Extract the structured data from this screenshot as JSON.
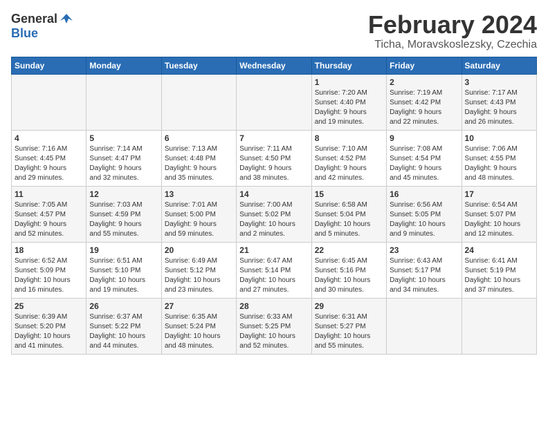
{
  "header": {
    "logo_general": "General",
    "logo_blue": "Blue",
    "month_title": "February 2024",
    "location": "Ticha, Moravskoslezsky, Czechia"
  },
  "days_of_week": [
    "Sunday",
    "Monday",
    "Tuesday",
    "Wednesday",
    "Thursday",
    "Friday",
    "Saturday"
  ],
  "weeks": [
    [
      {
        "day": "",
        "content": ""
      },
      {
        "day": "",
        "content": ""
      },
      {
        "day": "",
        "content": ""
      },
      {
        "day": "",
        "content": ""
      },
      {
        "day": "1",
        "content": "Sunrise: 7:20 AM\nSunset: 4:40 PM\nDaylight: 9 hours\nand 19 minutes."
      },
      {
        "day": "2",
        "content": "Sunrise: 7:19 AM\nSunset: 4:42 PM\nDaylight: 9 hours\nand 22 minutes."
      },
      {
        "day": "3",
        "content": "Sunrise: 7:17 AM\nSunset: 4:43 PM\nDaylight: 9 hours\nand 26 minutes."
      }
    ],
    [
      {
        "day": "4",
        "content": "Sunrise: 7:16 AM\nSunset: 4:45 PM\nDaylight: 9 hours\nand 29 minutes."
      },
      {
        "day": "5",
        "content": "Sunrise: 7:14 AM\nSunset: 4:47 PM\nDaylight: 9 hours\nand 32 minutes."
      },
      {
        "day": "6",
        "content": "Sunrise: 7:13 AM\nSunset: 4:48 PM\nDaylight: 9 hours\nand 35 minutes."
      },
      {
        "day": "7",
        "content": "Sunrise: 7:11 AM\nSunset: 4:50 PM\nDaylight: 9 hours\nand 38 minutes."
      },
      {
        "day": "8",
        "content": "Sunrise: 7:10 AM\nSunset: 4:52 PM\nDaylight: 9 hours\nand 42 minutes."
      },
      {
        "day": "9",
        "content": "Sunrise: 7:08 AM\nSunset: 4:54 PM\nDaylight: 9 hours\nand 45 minutes."
      },
      {
        "day": "10",
        "content": "Sunrise: 7:06 AM\nSunset: 4:55 PM\nDaylight: 9 hours\nand 48 minutes."
      }
    ],
    [
      {
        "day": "11",
        "content": "Sunrise: 7:05 AM\nSunset: 4:57 PM\nDaylight: 9 hours\nand 52 minutes."
      },
      {
        "day": "12",
        "content": "Sunrise: 7:03 AM\nSunset: 4:59 PM\nDaylight: 9 hours\nand 55 minutes."
      },
      {
        "day": "13",
        "content": "Sunrise: 7:01 AM\nSunset: 5:00 PM\nDaylight: 9 hours\nand 59 minutes."
      },
      {
        "day": "14",
        "content": "Sunrise: 7:00 AM\nSunset: 5:02 PM\nDaylight: 10 hours\nand 2 minutes."
      },
      {
        "day": "15",
        "content": "Sunrise: 6:58 AM\nSunset: 5:04 PM\nDaylight: 10 hours\nand 5 minutes."
      },
      {
        "day": "16",
        "content": "Sunrise: 6:56 AM\nSunset: 5:05 PM\nDaylight: 10 hours\nand 9 minutes."
      },
      {
        "day": "17",
        "content": "Sunrise: 6:54 AM\nSunset: 5:07 PM\nDaylight: 10 hours\nand 12 minutes."
      }
    ],
    [
      {
        "day": "18",
        "content": "Sunrise: 6:52 AM\nSunset: 5:09 PM\nDaylight: 10 hours\nand 16 minutes."
      },
      {
        "day": "19",
        "content": "Sunrise: 6:51 AM\nSunset: 5:10 PM\nDaylight: 10 hours\nand 19 minutes."
      },
      {
        "day": "20",
        "content": "Sunrise: 6:49 AM\nSunset: 5:12 PM\nDaylight: 10 hours\nand 23 minutes."
      },
      {
        "day": "21",
        "content": "Sunrise: 6:47 AM\nSunset: 5:14 PM\nDaylight: 10 hours\nand 27 minutes."
      },
      {
        "day": "22",
        "content": "Sunrise: 6:45 AM\nSunset: 5:16 PM\nDaylight: 10 hours\nand 30 minutes."
      },
      {
        "day": "23",
        "content": "Sunrise: 6:43 AM\nSunset: 5:17 PM\nDaylight: 10 hours\nand 34 minutes."
      },
      {
        "day": "24",
        "content": "Sunrise: 6:41 AM\nSunset: 5:19 PM\nDaylight: 10 hours\nand 37 minutes."
      }
    ],
    [
      {
        "day": "25",
        "content": "Sunrise: 6:39 AM\nSunset: 5:20 PM\nDaylight: 10 hours\nand 41 minutes."
      },
      {
        "day": "26",
        "content": "Sunrise: 6:37 AM\nSunset: 5:22 PM\nDaylight: 10 hours\nand 44 minutes."
      },
      {
        "day": "27",
        "content": "Sunrise: 6:35 AM\nSunset: 5:24 PM\nDaylight: 10 hours\nand 48 minutes."
      },
      {
        "day": "28",
        "content": "Sunrise: 6:33 AM\nSunset: 5:25 PM\nDaylight: 10 hours\nand 52 minutes."
      },
      {
        "day": "29",
        "content": "Sunrise: 6:31 AM\nSunset: 5:27 PM\nDaylight: 10 hours\nand 55 minutes."
      },
      {
        "day": "",
        "content": ""
      },
      {
        "day": "",
        "content": ""
      }
    ]
  ]
}
